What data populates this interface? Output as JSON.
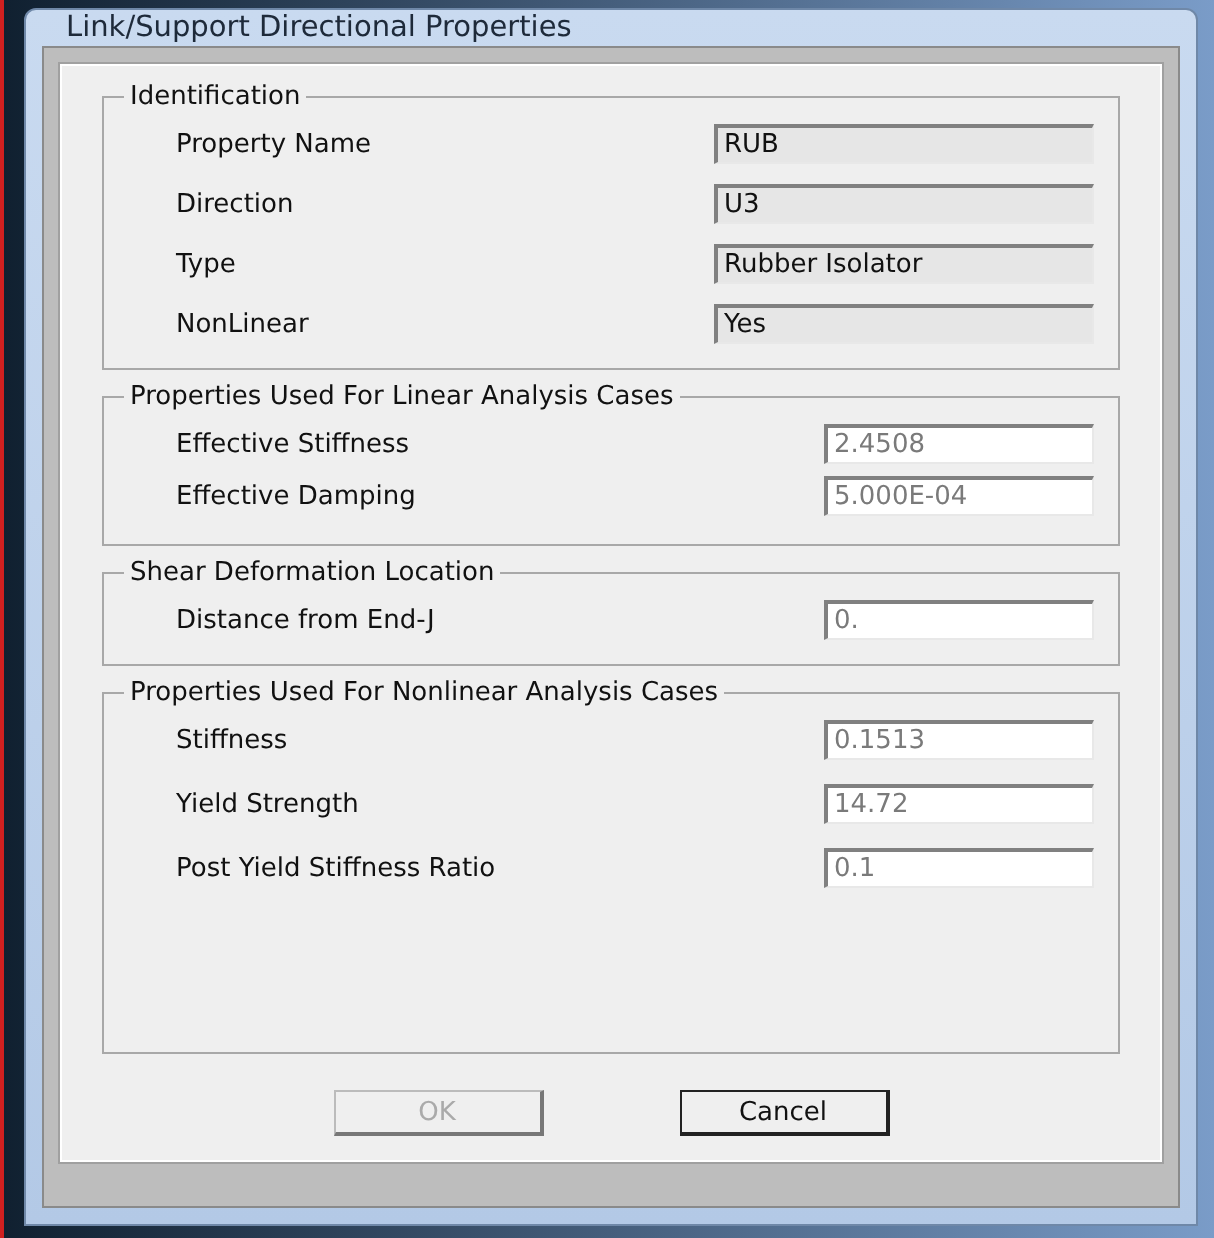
{
  "window": {
    "title": "Link/Support Directional Properties"
  },
  "groups": [
    {
      "title": "Identification",
      "fields": [
        {
          "label": "Property Name",
          "value": "RUB",
          "kind": "display"
        },
        {
          "label": "Direction",
          "value": "U3",
          "kind": "display"
        },
        {
          "label": "Type",
          "value": "Rubber Isolator",
          "kind": "display"
        },
        {
          "label": "NonLinear",
          "value": "Yes",
          "kind": "display"
        }
      ]
    },
    {
      "title": "Properties Used For Linear Analysis Cases",
      "fields": [
        {
          "label": "Effective Stiffness",
          "value": "2.4508",
          "kind": "entry"
        },
        {
          "label": "Effective Damping",
          "value": "5.000E-04",
          "kind": "entry"
        }
      ]
    },
    {
      "title": "Shear Deformation Location",
      "fields": [
        {
          "label": "Distance from End-J",
          "value": "0.",
          "kind": "entry"
        }
      ]
    },
    {
      "title": "Properties Used For Nonlinear Analysis Cases",
      "fields": [
        {
          "label": "Stiffness",
          "value": "0.1513",
          "kind": "entry"
        },
        {
          "label": "Yield Strength",
          "value": "14.72",
          "kind": "entry"
        },
        {
          "label": "Post Yield Stiffness Ratio",
          "value": "0.1",
          "kind": "entry"
        }
      ]
    }
  ],
  "buttons": [
    {
      "label": "OK",
      "disabled": true
    },
    {
      "label": "Cancel",
      "disabled": false
    }
  ]
}
